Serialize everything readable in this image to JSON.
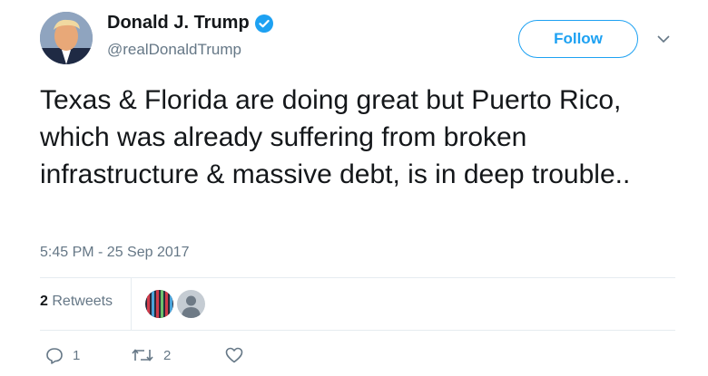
{
  "author": {
    "display_name": "Donald J. Trump",
    "handle": "@realDonaldTrump",
    "verified": true
  },
  "follow_button": {
    "label": "Follow"
  },
  "tweet": {
    "text": "Texas & Florida are doing great but Puerto Rico, which was already suffering from broken infrastructure & massive debt, is in deep trouble..",
    "timestamp": "5:45 PM - 25 Sep 2017"
  },
  "stats": {
    "retweet_count": "2",
    "retweet_label": "Retweets"
  },
  "actions": {
    "reply_count": "1",
    "retweet_count": "2"
  },
  "colors": {
    "accent": "#1da1f2",
    "secondary_text": "#657786",
    "divider": "#e6ecf0"
  },
  "icons": [
    "verified-badge-icon",
    "chevron-down-icon",
    "reply-icon",
    "retweet-icon",
    "like-icon"
  ]
}
